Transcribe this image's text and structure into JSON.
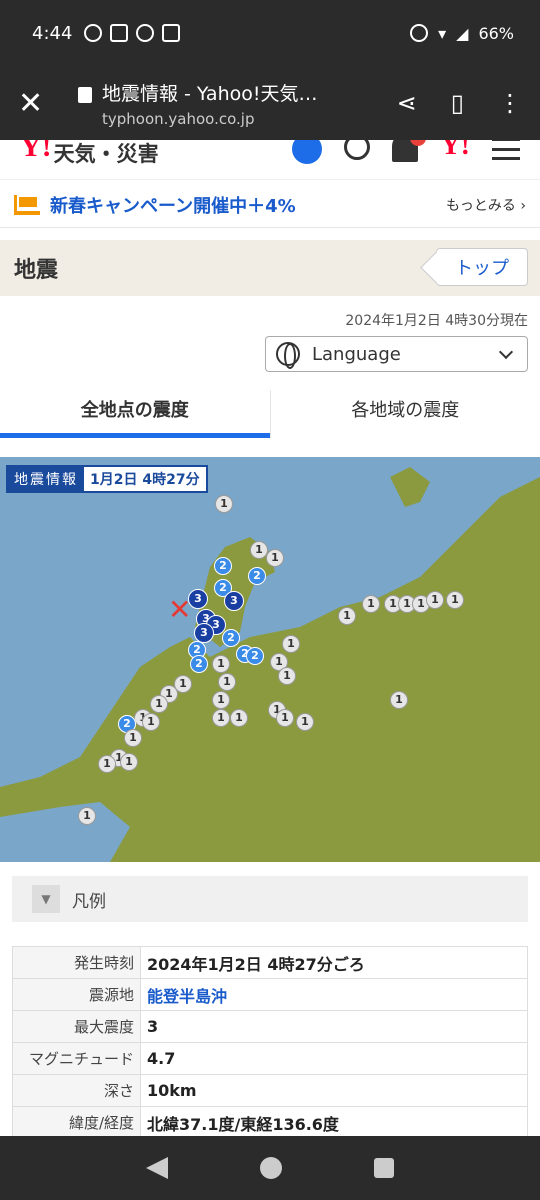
{
  "status": {
    "time": "4:44",
    "icons": [
      "LINE",
      "マンガUP!",
      "alarm",
      "news"
    ],
    "battery": "66%"
  },
  "browser": {
    "title": "地震情報 - Yahoo!天気…",
    "host": "typhoon.yahoo.co.jp"
  },
  "site": {
    "brand": "天気・災害",
    "logo": "Y!"
  },
  "campaign": {
    "text": "新春キャンペーン開催中＋4%",
    "more": "もっとみる ›"
  },
  "section": {
    "title": "地震",
    "top_button": "トップ"
  },
  "updated": "2024年1月2日 4時30分現在",
  "language_select": "Language",
  "tabs": [
    "全地点の震度",
    "各地域の震度"
  ],
  "map": {
    "label_a": "地震情報",
    "label_b": "1月2日 4時27分",
    "epicenter_icon": "x-mark-icon"
  },
  "legend": {
    "label": "凡例"
  },
  "info": [
    {
      "k": "発生時刻",
      "v": "2024年1月2日 4時27分ごろ"
    },
    {
      "k": "震源地",
      "v": "能登半島沖"
    },
    {
      "k": "最大震度",
      "v": "3"
    },
    {
      "k": "マグニチュード",
      "v": "4.7"
    },
    {
      "k": "深さ",
      "v": "10km"
    },
    {
      "k": "緯度/経度",
      "v": "北緯37.1度/東経136.6度"
    }
  ],
  "colors": {
    "accent": "#1d6ce8",
    "yahoo_red": "#ff0033",
    "intensity3": "#1a3fa3",
    "intensity2": "#3b8be8"
  }
}
